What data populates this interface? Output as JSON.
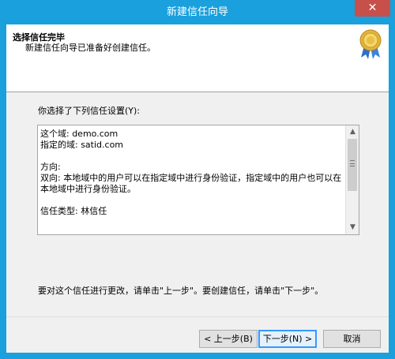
{
  "window": {
    "title": "新建信任向导",
    "close_glyph": "✕"
  },
  "header": {
    "title": "选择信任完毕",
    "subtitle": "新建信任向导已准备好创建信任。",
    "icon": "certificate-icon"
  },
  "main": {
    "list_label": "你选择了下列信任设置(Y):",
    "settings_text": "这个域: demo.com\n指定的域: satid.com\n\n方向:\n双向: 本地域中的用户可以在指定域中进行身份验证，指定域中的用户也可以在本地域中进行身份验证。\n\n信任类型: 林信任",
    "hint": "要对这个信任进行更改，请单击\"上一步\"。要创建信任，请单击\"下一步\"。"
  },
  "footer": {
    "back_label": "< 上一步(B)",
    "next_label": "下一步(N) >",
    "cancel_label": "取消"
  },
  "colors": {
    "titlebar": "#19a0dd",
    "close": "#c7504b",
    "panel": "#f0f0f0"
  }
}
